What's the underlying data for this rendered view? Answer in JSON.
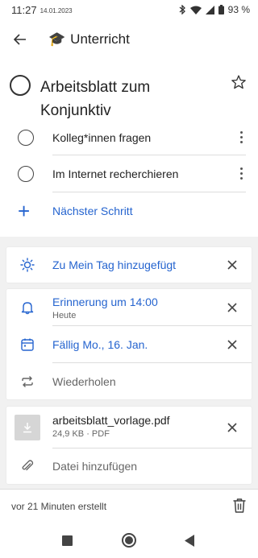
{
  "status": {
    "time": "11:27",
    "date": "14.01.2023",
    "battery": "93 %"
  },
  "header": {
    "list_icon": "🎓",
    "list_name": "Unterricht"
  },
  "task": {
    "title": "Arbeitsblatt zum Konjunktiv"
  },
  "steps": [
    {
      "label": "Kolleg*innen fragen"
    },
    {
      "label": "Im Internet recherchieren"
    }
  ],
  "add_step_label": "Nächster Schritt",
  "my_day": {
    "label": "Zu Mein Tag hinzugefügt"
  },
  "reminder": {
    "label": "Erinnerung um 14:00",
    "sub": "Heute"
  },
  "due": {
    "label": "Fällig Mo., 16. Jan."
  },
  "repeat": {
    "label": "Wiederholen"
  },
  "file": {
    "name": "arbeitsblatt_vorlage.pdf",
    "meta": "24,9 KB · PDF"
  },
  "add_file_label": "Datei hinzufügen",
  "footer": {
    "created": "vor 21 Minuten erstellt"
  },
  "colors": {
    "accent": "#2564cf",
    "background": "#f1f1f1"
  },
  "icons": {
    "back": "arrow-left-icon",
    "star": "star-outline-icon",
    "sun": "sun-icon",
    "bell": "bell-icon",
    "calendar": "calendar-icon",
    "repeat": "repeat-icon",
    "download": "download-icon",
    "paperclip": "paperclip-icon",
    "trash": "trash-icon"
  }
}
